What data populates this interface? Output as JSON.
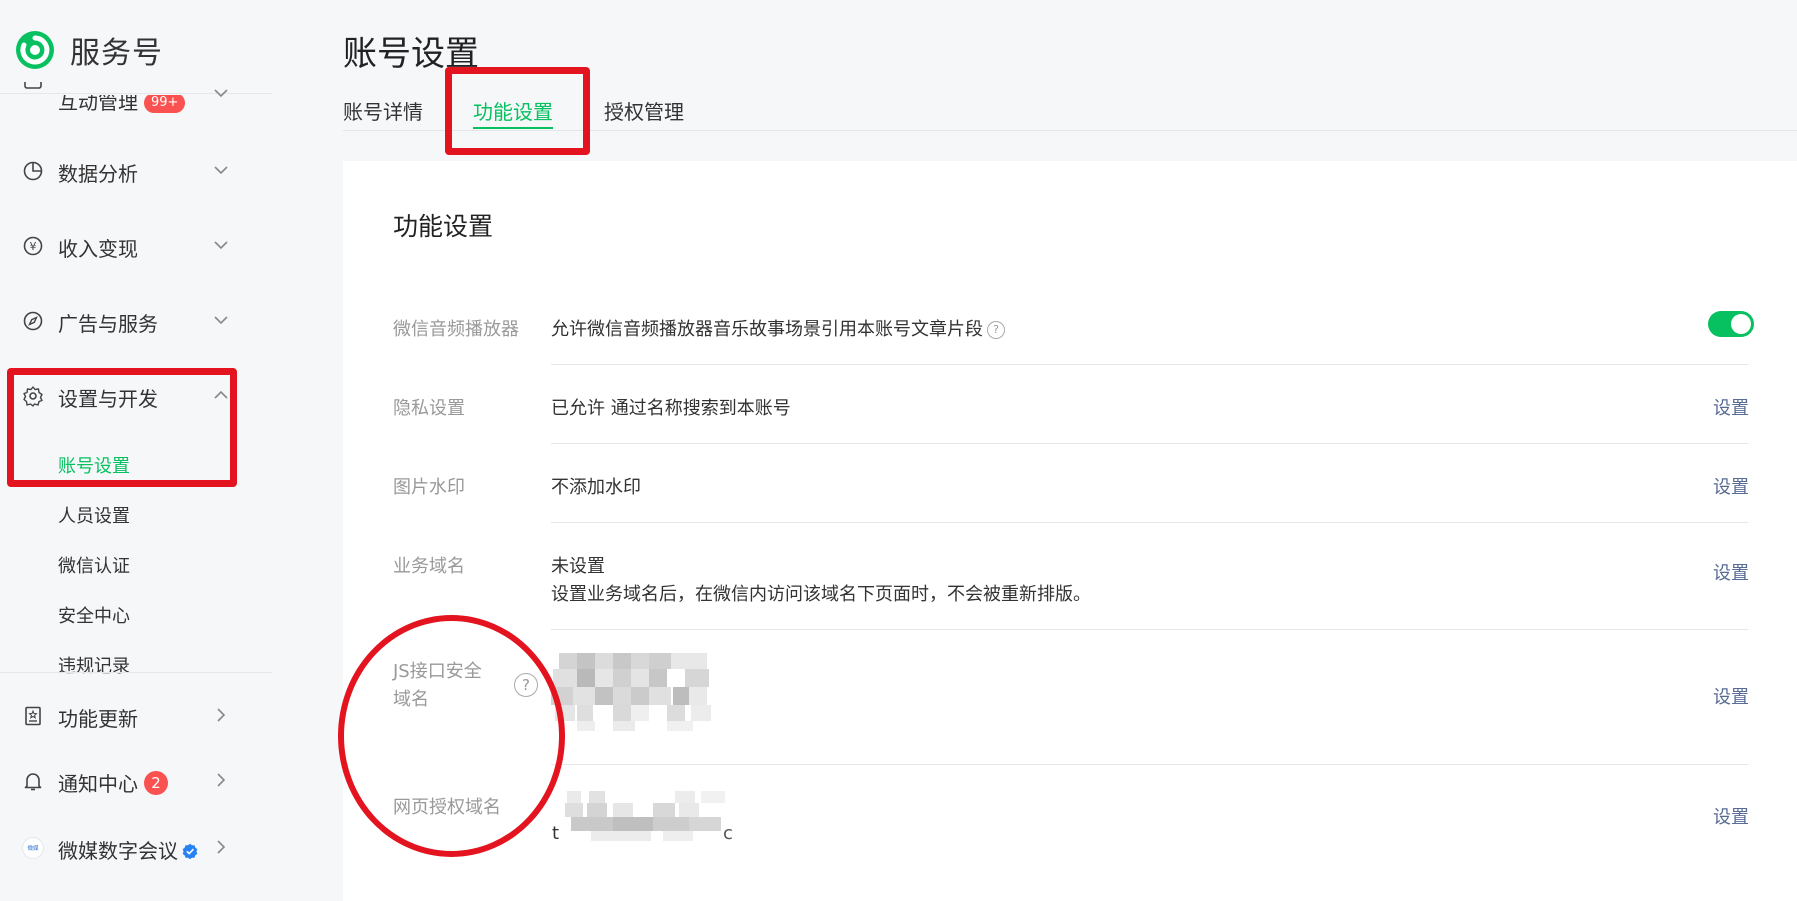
{
  "app": {
    "name": "服务号"
  },
  "sidebar": {
    "groups": [
      {
        "label": "互动管理",
        "badge": "99+"
      },
      {
        "label": "数据分析"
      },
      {
        "label": "收入变现"
      },
      {
        "label": "广告与服务"
      },
      {
        "label": "设置与开发"
      }
    ],
    "sub_items": [
      "账号设置",
      "人员设置",
      "微信认证",
      "安全中心",
      "违规记录"
    ],
    "bottom": [
      {
        "label": "功能更新"
      },
      {
        "label": "通知中心",
        "badge": "2"
      },
      {
        "label": "微媒数字会议"
      }
    ]
  },
  "page": {
    "title": "账号设置",
    "tabs": [
      "账号详情",
      "功能设置",
      "授权管理"
    ],
    "active_tab": "功能设置"
  },
  "card": {
    "title": "功能设置",
    "rows": [
      {
        "label": "微信音频播放器",
        "value": "允许微信音频播放器音乐故事场景引用本账号文章片段",
        "toggle_on": true
      },
      {
        "label": "隐私设置",
        "value": "已允许 通过名称搜索到本账号",
        "action": "设置"
      },
      {
        "label": "图片水印",
        "value": "不添加水印",
        "action": "设置"
      },
      {
        "label": "业务域名",
        "value": "未设置",
        "note": "设置业务域名后，在微信内访问该域名下页面时，不会被重新排版。",
        "action": "设置"
      },
      {
        "label": "JS接口安全域名",
        "action": "设置"
      },
      {
        "label": "网页授权域名",
        "action": "设置"
      }
    ]
  },
  "colors": {
    "accent": "#07c160",
    "link": "#576b95",
    "annotation_red": "#e3141f",
    "badge": "#fa5151"
  },
  "icons": [
    "logo-icon",
    "chat-icon",
    "pie-chart-icon",
    "yen-icon",
    "compass-icon",
    "gear-icon",
    "chevron-down-icon",
    "chevron-up-icon",
    "chevron-right-icon",
    "book-icon",
    "bell-icon",
    "verified-icon",
    "help-icon"
  ]
}
